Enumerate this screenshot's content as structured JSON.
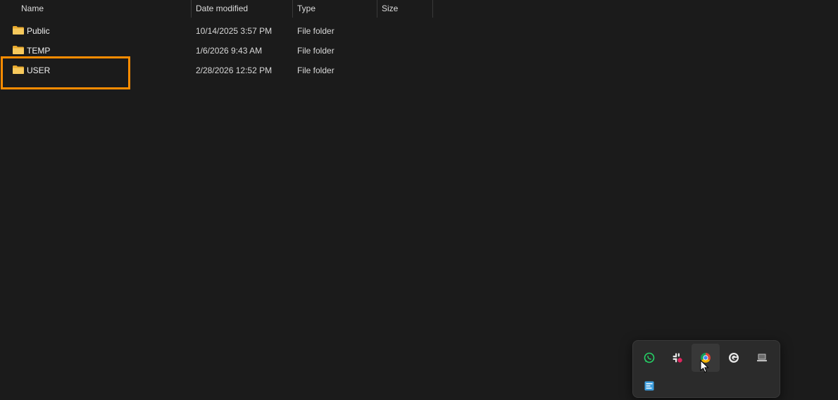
{
  "columns": {
    "name": "Name",
    "date": "Date modified",
    "type": "Type",
    "size": "Size"
  },
  "rows": [
    {
      "name": "Public",
      "date": "10/14/2025 3:57 PM",
      "type": "File folder",
      "size": ""
    },
    {
      "name": "TEMP",
      "date": "1/6/2026 9:43 AM",
      "type": "File folder",
      "size": ""
    },
    {
      "name": "USER",
      "date": "2/28/2026 12:52 PM",
      "type": "File folder",
      "size": ""
    }
  ],
  "colors": {
    "background": "#1b1b1b",
    "folder": "#f2c14e",
    "highlight": "#ff8c00"
  },
  "tray_icons": [
    "whatsapp-icon",
    "slack-icon",
    "chrome-icon",
    "grammarly-icon",
    "laptop-icon",
    "network-app-icon"
  ]
}
